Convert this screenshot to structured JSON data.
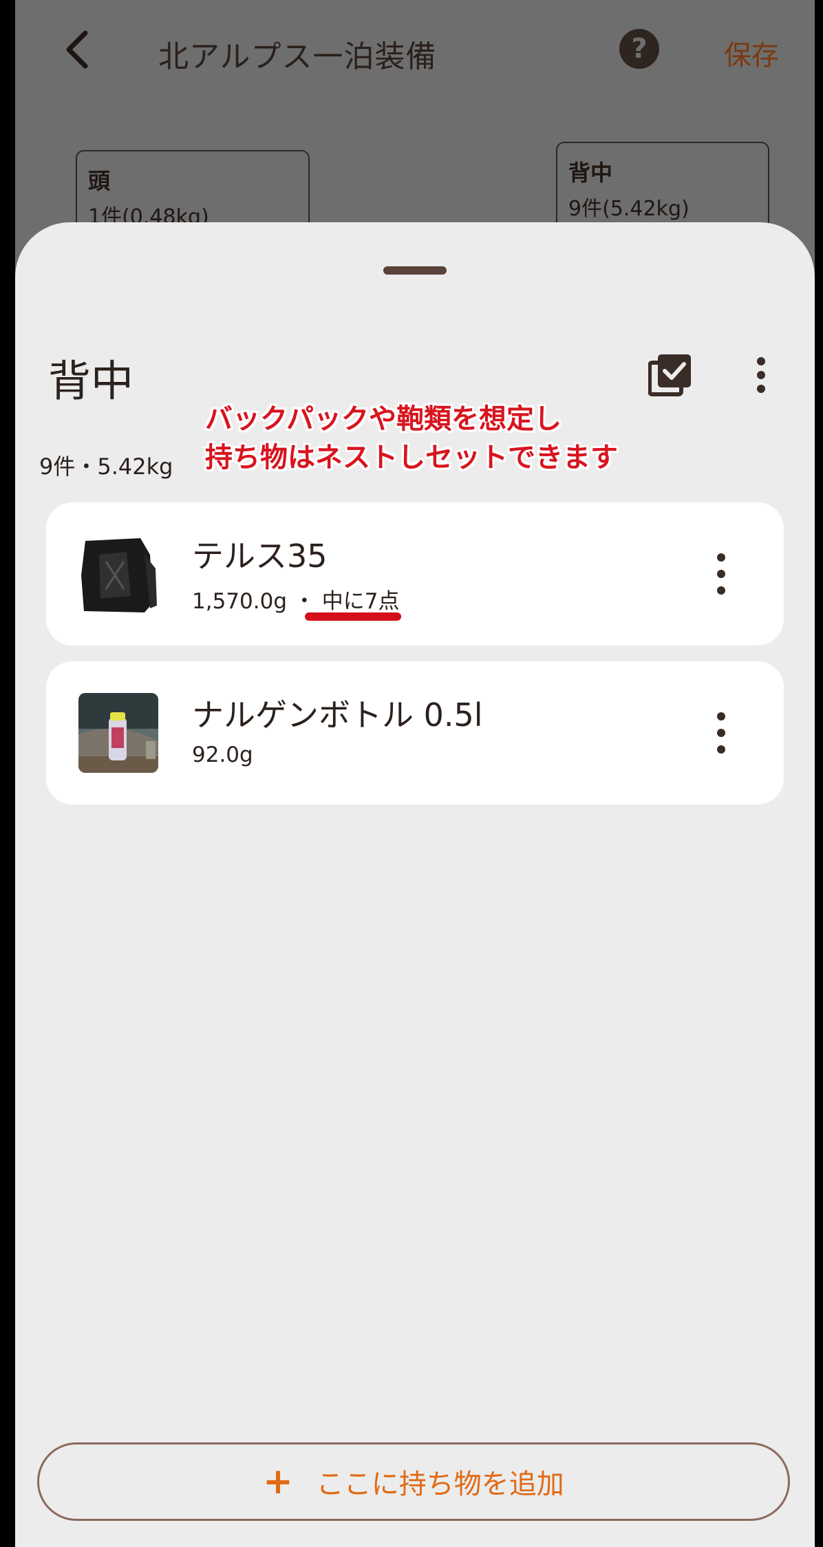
{
  "header": {
    "title": "北アルプス一泊装備",
    "save_label": "保存",
    "help_symbol": "?"
  },
  "background_groups": [
    {
      "name": "頭",
      "summary": "1件(0.48kg)"
    },
    {
      "name": "背中",
      "summary": "9件(5.42kg)"
    }
  ],
  "sheet": {
    "title": "背中",
    "summary": "9件・5.42kg",
    "annotation_line1": "バックパックや鞄類を想定し",
    "annotation_line2": "持ち物はネストしセットできます",
    "items": [
      {
        "name": "テルス35",
        "weight": "1,570.0g",
        "separator": "・",
        "nested": "中に7点"
      },
      {
        "name": "ナルゲンボトル 0.5l",
        "weight": "92.0g"
      }
    ],
    "add_button": {
      "icon": "+",
      "label": "ここに持ち物を追加"
    }
  },
  "colors": {
    "accent": "#e06a16",
    "annotation": "#d8141e",
    "text": "#2b211d",
    "sheet_bg": "#ececec"
  }
}
